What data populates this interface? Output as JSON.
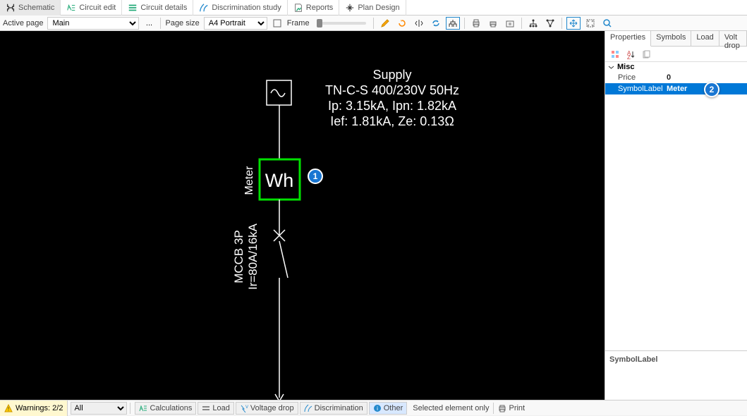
{
  "tabs": {
    "schematic": "Schematic",
    "circuit_edit": "Circuit edit",
    "circuit_details": "Circuit details",
    "discrimination": "Discrimination study",
    "reports": "Reports",
    "plan_design": "Plan Design"
  },
  "toolbar": {
    "active_page_label": "Active page",
    "active_page_value": "Main",
    "page_size_label": "Page size",
    "page_size_value": "A4 Portrait",
    "frame_label": "Frame",
    "ellipsis": "..."
  },
  "schematic": {
    "supply_title": "Supply",
    "supply_line1": "TN-C-S 400/230V 50Hz",
    "supply_line2": "Ip: 3.15kA, Ipn: 1.82kA",
    "supply_line3": "Ief: 1.81kA, Ze: 0.13Ω",
    "meter_label": "Meter",
    "meter_symbol": "Wh",
    "mccb_line1": "MCCB 3P",
    "mccb_line2": "Ir=80A/16kA"
  },
  "properties": {
    "tabs": {
      "properties": "Properties",
      "symbols": "Symbols",
      "load": "Load",
      "voltdrop": "Volt drop"
    },
    "category": "Misc",
    "rows": [
      {
        "name": "Price",
        "value": "0"
      },
      {
        "name": "SymbolLabel",
        "value": "Meter"
      }
    ],
    "footer": "SymbolLabel"
  },
  "bottom": {
    "warnings": "Warnings: 2/2",
    "filter": "All",
    "calculations": "Calculations",
    "load": "Load",
    "voltage_drop": "Voltage drop",
    "discrimination": "Discrimination",
    "other": "Other",
    "selected_only": "Selected element only",
    "print": "Print"
  },
  "callouts": {
    "c1": "1",
    "c2": "2"
  }
}
